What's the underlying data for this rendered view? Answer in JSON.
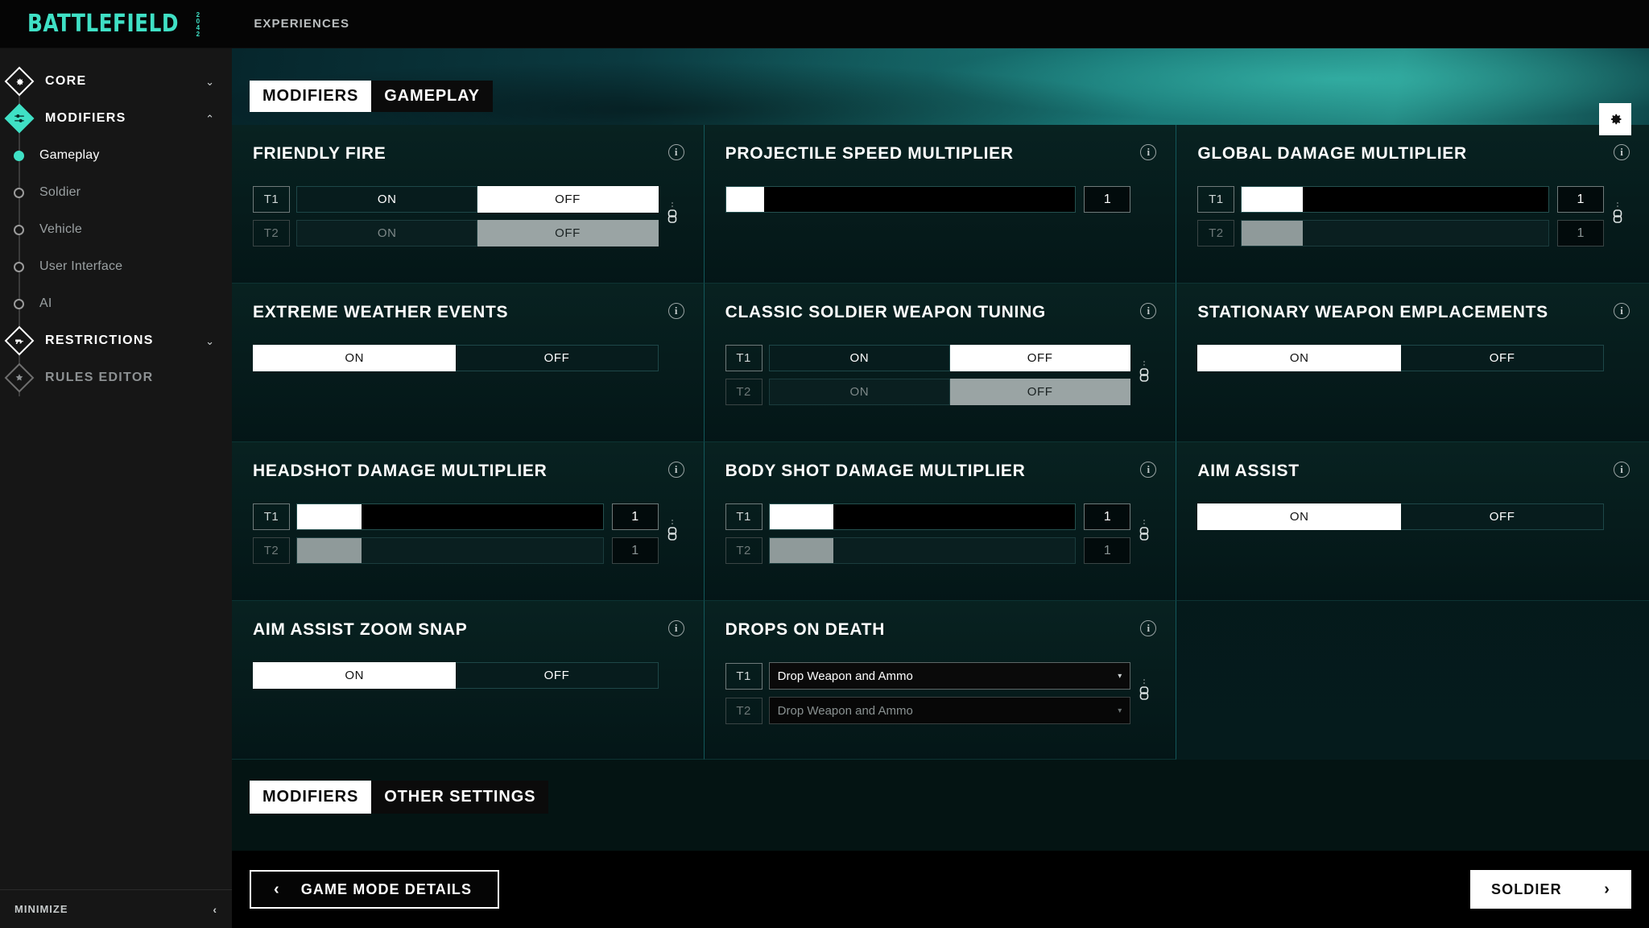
{
  "brand": {
    "name": "BATTLEFIELD",
    "edition": "2042"
  },
  "topnav": {
    "items": [
      {
        "label": "EXPERIENCES"
      }
    ]
  },
  "sidebar": {
    "groups": [
      {
        "label": "CORE",
        "icon": "gear-diamond-icon",
        "state": "collapsed",
        "chevron": "⌄"
      },
      {
        "label": "MODIFIERS",
        "icon": "sliders-diamond-icon",
        "state": "expanded",
        "chevron": "⌃"
      }
    ],
    "modifier_items": [
      {
        "label": "Gameplay",
        "active": true
      },
      {
        "label": "Soldier",
        "active": false
      },
      {
        "label": "Vehicle",
        "active": false
      },
      {
        "label": "User Interface",
        "active": false
      },
      {
        "label": "AI",
        "active": false
      }
    ],
    "lower_groups": [
      {
        "label": "RESTRICTIONS",
        "icon": "weapon-diamond-icon",
        "chevron": "⌄"
      },
      {
        "label": "RULES EDITOR",
        "icon": "rules-diamond-icon",
        "chevron": ""
      }
    ],
    "minimize": {
      "label": "MINIMIZE",
      "chevron": "‹"
    }
  },
  "header": {
    "breadcrumb": [
      {
        "label": "MODIFIERS",
        "selected": true
      },
      {
        "label": "GAMEPLAY",
        "selected": false
      }
    ],
    "settings_icon": "gear-icon"
  },
  "section": {
    "tabs": [
      {
        "label": "MODIFIERS",
        "selected": true
      },
      {
        "label": "OTHER SETTINGS",
        "selected": false
      }
    ]
  },
  "labels": {
    "t1": "T1",
    "t2": "T2",
    "on": "ON",
    "off": "OFF",
    "info": "i",
    "caret": "▾"
  },
  "cards": [
    {
      "title": "FRIENDLY FIRE",
      "type": "team-toggle",
      "rows": [
        {
          "team": "T1",
          "selected": "OFF",
          "dim": false
        },
        {
          "team": "T2",
          "selected": "OFF",
          "dim": true
        }
      ],
      "linked": true
    },
    {
      "title": "PROJECTILE SPEED MULTIPLIER",
      "type": "slider",
      "rows": [
        {
          "fill_percent": 11,
          "value": "1",
          "dim": false
        }
      ],
      "linked": false
    },
    {
      "title": "GLOBAL DAMAGE MULTIPLIER",
      "type": "team-slider",
      "rows": [
        {
          "team": "T1",
          "fill_percent": 20,
          "value": "1",
          "dim": false
        },
        {
          "team": "T2",
          "fill_percent": 20,
          "value": "1",
          "dim": true
        }
      ],
      "linked": true
    },
    {
      "title": "EXTREME WEATHER EVENTS",
      "type": "toggle",
      "rows": [
        {
          "selected": "ON",
          "dim": false
        }
      ],
      "linked": false
    },
    {
      "title": "CLASSIC SOLDIER WEAPON TUNING",
      "type": "team-toggle",
      "rows": [
        {
          "team": "T1",
          "selected": "OFF",
          "dim": false
        },
        {
          "team": "T2",
          "selected": "OFF",
          "dim": true
        }
      ],
      "linked": true
    },
    {
      "title": "STATIONARY WEAPON EMPLACEMENTS",
      "type": "toggle",
      "rows": [
        {
          "selected": "ON",
          "dim": false
        }
      ],
      "linked": false
    },
    {
      "title": "HEADSHOT DAMAGE MULTIPLIER",
      "type": "team-slider",
      "rows": [
        {
          "team": "T1",
          "fill_percent": 21,
          "value": "1",
          "dim": false
        },
        {
          "team": "T2",
          "fill_percent": 21,
          "value": "1",
          "dim": true
        }
      ],
      "linked": true
    },
    {
      "title": "BODY SHOT DAMAGE MULTIPLIER",
      "type": "team-slider",
      "rows": [
        {
          "team": "T1",
          "fill_percent": 21,
          "value": "1",
          "dim": false
        },
        {
          "team": "T2",
          "fill_percent": 21,
          "value": "1",
          "dim": true
        }
      ],
      "linked": true
    },
    {
      "title": "AIM ASSIST",
      "type": "toggle",
      "rows": [
        {
          "selected": "ON",
          "dim": false
        }
      ],
      "linked": false
    },
    {
      "title": "AIM ASSIST ZOOM SNAP",
      "type": "toggle",
      "rows": [
        {
          "selected": "ON",
          "dim": false
        }
      ],
      "linked": false
    },
    {
      "title": "DROPS ON DEATH",
      "type": "team-dropdown",
      "rows": [
        {
          "team": "T1",
          "value": "Drop Weapon and Ammo",
          "dim": false
        },
        {
          "team": "T2",
          "value": "Drop Weapon and Ammo",
          "dim": true
        }
      ],
      "linked": true
    }
  ],
  "footer": {
    "back_button": {
      "label": "GAME MODE DETAILS",
      "chevron": "‹"
    },
    "next_button": {
      "label": "SOLDIER",
      "chevron": "›"
    }
  },
  "colors": {
    "accent": "#3fe0c5",
    "hero_teal": "#2a9a92",
    "card_bg": "#082221",
    "divider": "#13575a"
  }
}
